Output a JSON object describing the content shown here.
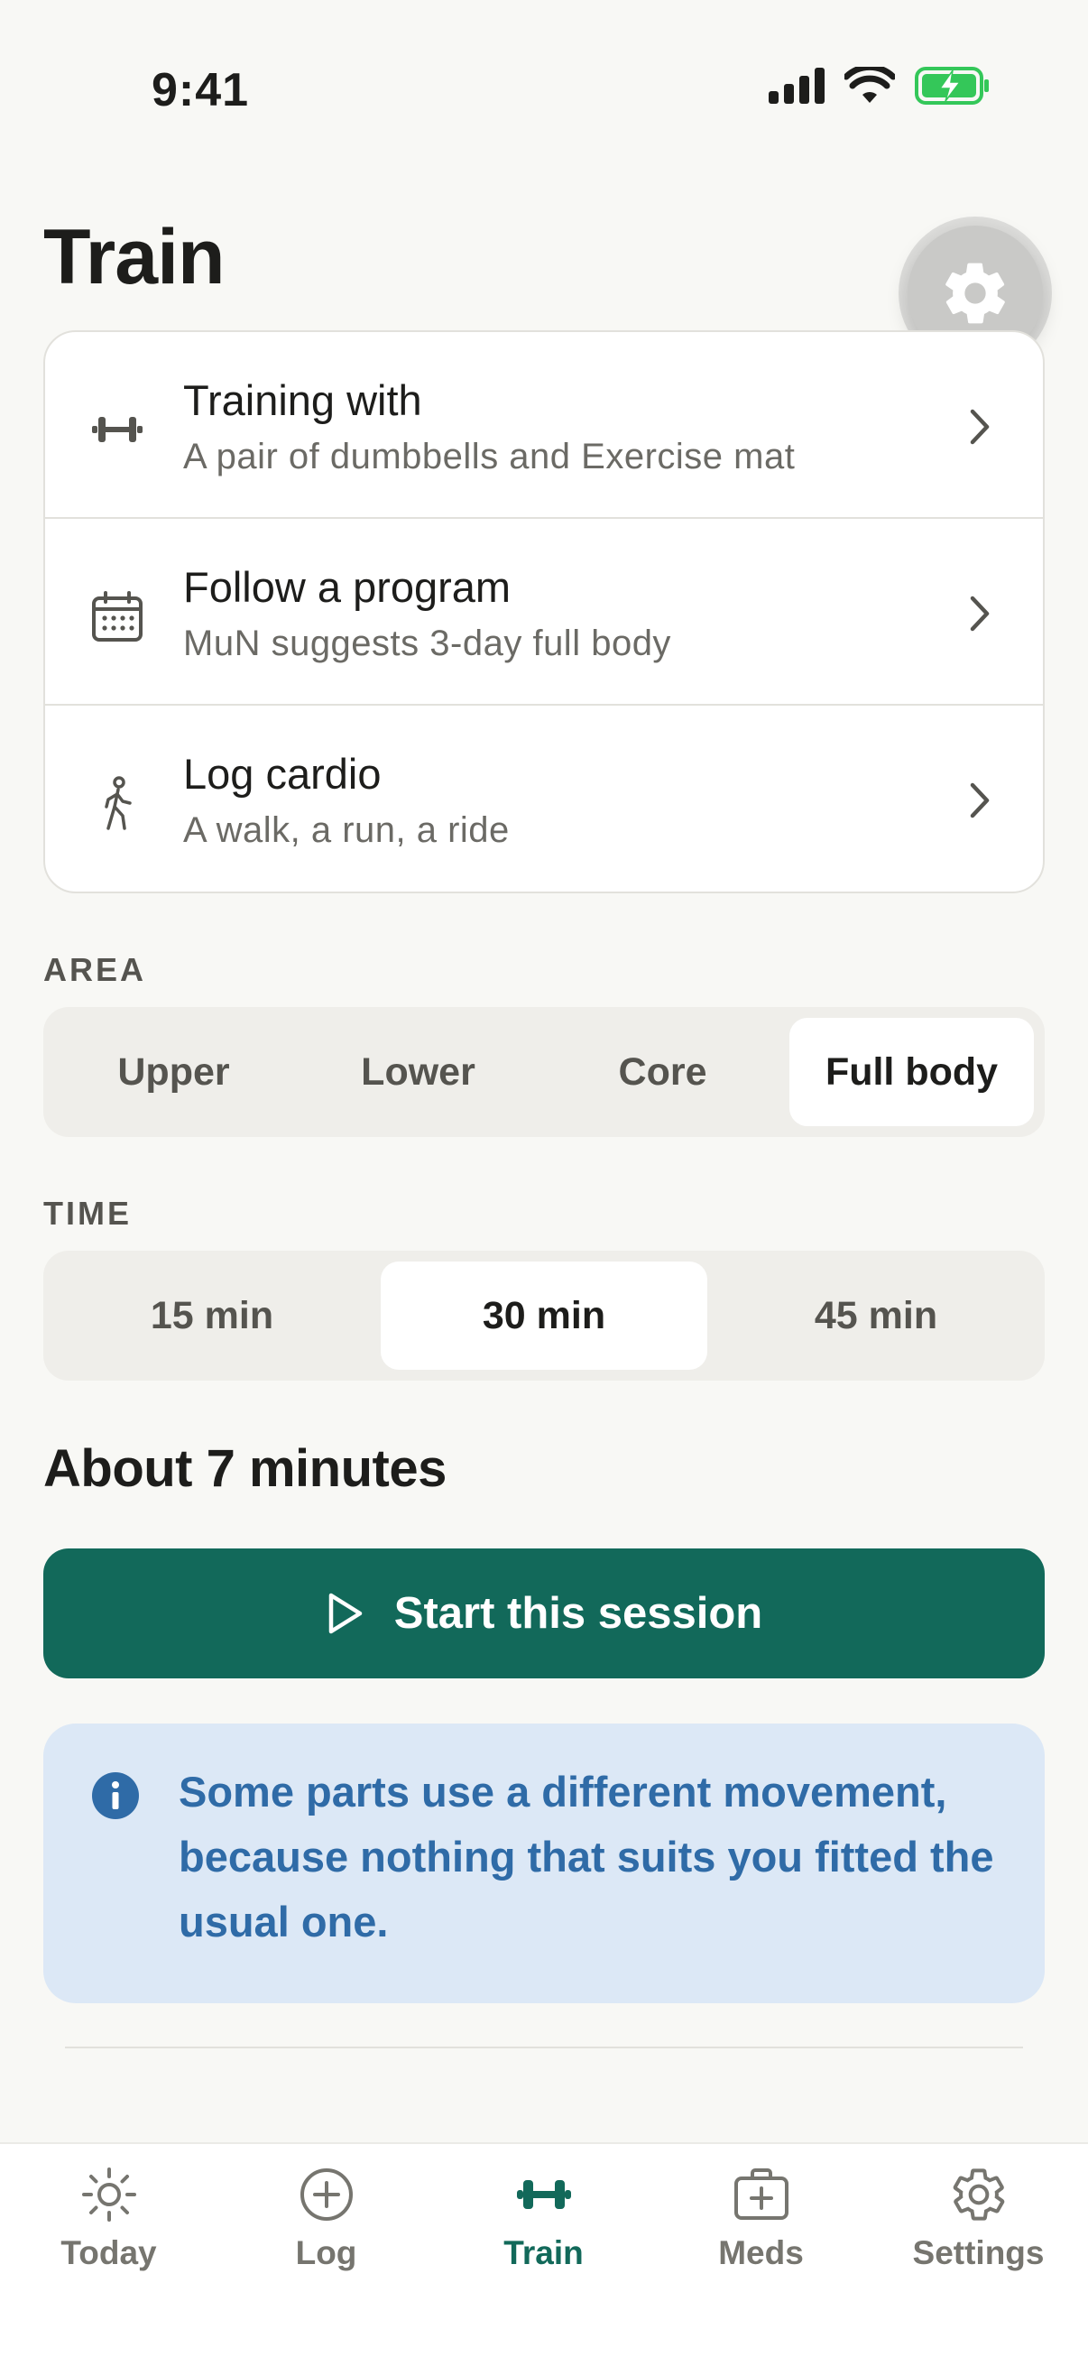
{
  "status_bar": {
    "time": "9:41"
  },
  "header": {
    "title": "Train"
  },
  "card": {
    "rows": [
      {
        "title": "Training with",
        "subtitle": "A pair of dumbbells and Exercise mat",
        "icon": "dumbbell-icon"
      },
      {
        "title": "Follow a program",
        "subtitle": "MuN suggests 3-day full body",
        "icon": "calendar-icon"
      },
      {
        "title": "Log cardio",
        "subtitle": "A walk, a run, a ride",
        "icon": "walking-person-icon"
      }
    ]
  },
  "area": {
    "label": "AREA",
    "options": [
      "Upper",
      "Lower",
      "Core",
      "Full body"
    ],
    "selected": "Full body"
  },
  "time": {
    "label": "TIME",
    "options": [
      "15 min",
      "30 min",
      "45 min"
    ],
    "selected": "30 min"
  },
  "summary": "About 7 minutes",
  "start_button": {
    "label": "Start this session",
    "icon": "play-icon"
  },
  "info": {
    "text": "Some parts use a different movement, because nothing that suits you fitted the usual one.",
    "icon": "info-icon"
  },
  "tab_bar": {
    "tabs": [
      {
        "label": "Today",
        "icon": "sun-icon"
      },
      {
        "label": "Log",
        "icon": "plus-circle-icon"
      },
      {
        "label": "Train",
        "icon": "dumbbell-icon"
      },
      {
        "label": "Meds",
        "icon": "medkit-icon"
      },
      {
        "label": "Settings",
        "icon": "gear-icon"
      }
    ],
    "active": "Train"
  },
  "colors": {
    "accent": "#12695a",
    "background": "#f8f8f5",
    "info_bg": "#dce8f6",
    "info_text": "#2f6ba7",
    "battery": "#34c759"
  }
}
